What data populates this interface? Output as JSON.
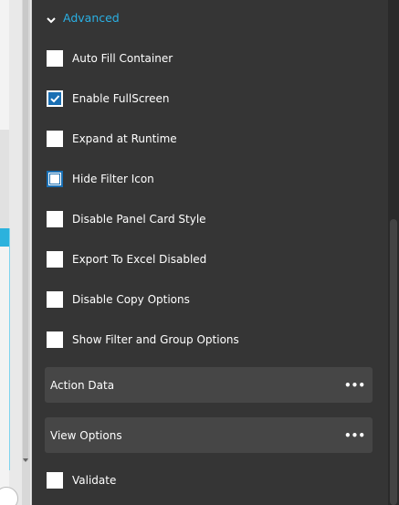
{
  "advanced_section": {
    "header_label": "Advanced",
    "options": [
      {
        "label": "Auto Fill Container",
        "checked": false
      },
      {
        "label": "Enable FullScreen",
        "checked": true
      },
      {
        "label": "Expand at Runtime",
        "checked": false
      },
      {
        "label": "Hide Filter Icon",
        "checked": false,
        "focused": true
      },
      {
        "label": "Disable Panel Card Style",
        "checked": false
      },
      {
        "label": "Export To Excel Disabled",
        "checked": false
      },
      {
        "label": "Disable Copy Options",
        "checked": false
      },
      {
        "label": "Show Filter and Group Options",
        "checked": false
      }
    ]
  },
  "cards": [
    {
      "label": "Action Data",
      "menu_glyph": "•••"
    },
    {
      "label": "View Options",
      "menu_glyph": "•••"
    }
  ],
  "validate": {
    "label": "Validate",
    "checked": false
  },
  "icons": {
    "header": "chevron-down-icon",
    "checkmark": "check-icon",
    "card_menu": "more-horizontal-icon"
  },
  "colors": {
    "panel_bg": "#353535",
    "card_bg": "#464646",
    "accent": "#2ab0e4",
    "checkbox_checked": "#1a6fb3"
  }
}
